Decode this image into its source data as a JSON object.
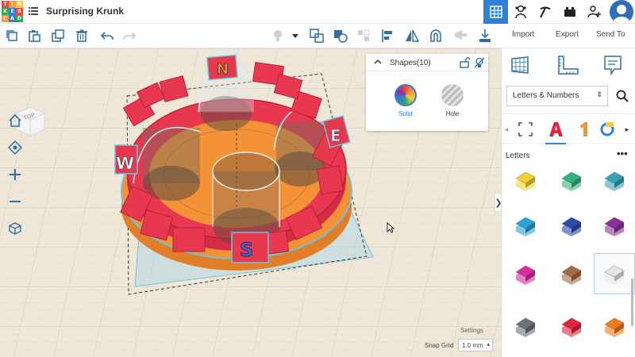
{
  "app": {
    "title": "Surprising Krunk",
    "logo_letters": [
      "T",
      "I",
      "N",
      "K",
      "E",
      "R",
      "C",
      "A",
      "D"
    ],
    "logo_colors": [
      "#e94b3c",
      "#f39c3d",
      "#f7c948",
      "#3aa956",
      "#2f80d8",
      "#e94b3c",
      "#f39c3d",
      "#2f80d8",
      "#3aa956"
    ]
  },
  "topbar": {
    "icons": [
      "grid-view-icon",
      "gallery-icon",
      "pickaxe-icon",
      "bricks-icon",
      "add-user-icon",
      "avatar"
    ]
  },
  "toolbar": {
    "import_label": "Import",
    "export_label": "Export",
    "sendto_label": "Send To"
  },
  "viewcube": {
    "label": "TOP"
  },
  "inspector": {
    "title": "Shapes(10)",
    "solid_label": "Solid",
    "hole_label": "Hole"
  },
  "viewport": {
    "settings_label": "Settings",
    "snap_label": "Snap Grid",
    "snap_value": "1.0 mm"
  },
  "scene": {
    "letters": [
      "N",
      "E",
      "S",
      "W"
    ]
  },
  "library": {
    "category_select": "Letters & Numbers",
    "section_title": "Letters",
    "more": "•••",
    "tiles": [
      {
        "name": "letter-o-yellow",
        "color": "#f2d230"
      },
      {
        "name": "letter-p-green",
        "color": "#34b27d"
      },
      {
        "name": "letter-q-teal",
        "color": "#3aa1b5"
      },
      {
        "name": "letter-r-cyan",
        "color": "#29a4d6"
      },
      {
        "name": "letter-s-navy",
        "color": "#2f4aa8"
      },
      {
        "name": "letter-t-purple",
        "color": "#8c2f9b"
      },
      {
        "name": "letter-u-magenta",
        "color": "#d72d9e"
      },
      {
        "name": "letter-v-brown",
        "color": "#a36a45"
      },
      {
        "name": "letter-w-white",
        "color": "#e6e6e6"
      },
      {
        "name": "letter-x-gray",
        "color": "#6d7278"
      },
      {
        "name": "letter-y-red",
        "color": "#e3233b"
      },
      {
        "name": "letter-z-orange",
        "color": "#ef7a1f"
      }
    ]
  },
  "colors": {
    "accent": "#2f80d8",
    "red_shape": "#e8384f",
    "orange_base": "#f39237",
    "workplane": "#efe8d8",
    "grid_blue": "#a9d3e6"
  }
}
